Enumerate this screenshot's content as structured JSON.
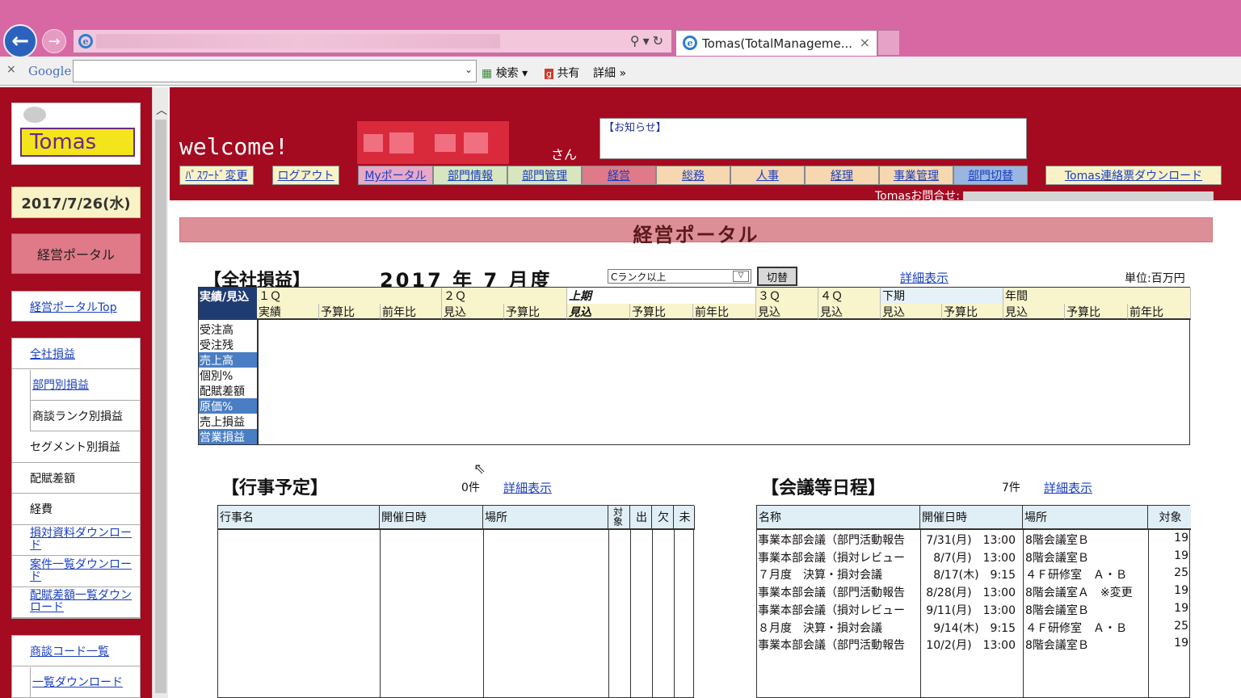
{
  "browser": {
    "tab_title": "Tomas(TotalManageme...",
    "tab_close": "×",
    "toolbar_close": "×",
    "google_logo": "Google",
    "search_label": "検索",
    "share_label": "共有",
    "detail_label": "詳細 »",
    "nav_back_icon": "back-arrow-icon",
    "nav_forward_icon": "forward-arrow-icon"
  },
  "sidebar": {
    "logo_text": "Tomas",
    "date": "2017/7/26(水)",
    "portal": "経営ポータル",
    "top_link": "経営ポータルTop",
    "group1": [
      {
        "label": "全社損益",
        "link": true
      },
      {
        "label": "部門別損益",
        "link": true,
        "sub": true
      },
      {
        "label": "商談ランク別損益",
        "link": false,
        "sub": true
      },
      {
        "label": "セグメント別損益",
        "link": false
      },
      {
        "label": "配賦差額",
        "link": false
      },
      {
        "label": "経費",
        "link": false
      },
      {
        "label": "損対資料ダウンロード",
        "link": true
      },
      {
        "label": "案件一覧ダウンロード",
        "link": true
      },
      {
        "label": "配賦差額一覧ダウンロード",
        "link": true
      }
    ],
    "group2": [
      {
        "label": "商談コード一覧",
        "link": true
      },
      {
        "label": "一覧ダウンロード",
        "link": true,
        "sub": true
      }
    ]
  },
  "header": {
    "welcome": "welcome!",
    "san": "さん",
    "notice_label": "【お知らせ】",
    "nav": [
      {
        "label": "ﾊﾟｽﾜｰﾄﾞ変更",
        "bg": "#f8f2c6"
      },
      {
        "label": "ログアウト",
        "bg": "#f8f2c6"
      },
      {
        "label": "Myポータル",
        "bg": "#e8a8c8"
      },
      {
        "label": "部門情報",
        "bg": "#d8e6c0"
      },
      {
        "label": "部門管理",
        "bg": "#d8e6c0"
      },
      {
        "label": "経営",
        "bg": "#e07a88"
      },
      {
        "label": "総務",
        "bg": "#f6d7b0"
      },
      {
        "label": "人事",
        "bg": "#f6d7b0"
      },
      {
        "label": "経理",
        "bg": "#f6d7b0"
      },
      {
        "label": "事業管理",
        "bg": "#f6d7b0"
      },
      {
        "label": "部門切替",
        "bg": "#9ab6e0"
      },
      {
        "label": "Tomas連絡票ダウンロード",
        "bg": "#f8f2c6"
      }
    ],
    "inquiry": "Tomasお問合せ:"
  },
  "main": {
    "title": "経営ポータル",
    "pl": {
      "heading": "【全社損益】",
      "period": "2017 年 7 月度",
      "rank_select": "Cランク以上",
      "switch_button": "切替",
      "detail_link": "詳細表示",
      "unit": "単位:百万円",
      "corner": "実績/見込",
      "groups": [
        "１Ｑ",
        "２Ｑ",
        "上期",
        "３Ｑ",
        "４Ｑ",
        "下期",
        "年間"
      ],
      "subcols": [
        "実績",
        "予算比",
        "前年比",
        "見込",
        "予算比",
        "見込",
        "予算比",
        "前年比",
        "見込",
        "見込",
        "見込",
        "予算比",
        "見込",
        "予算比",
        "前年比"
      ],
      "rows": [
        "受注高",
        "受注残",
        "売上高",
        "個別%",
        "配賦差額",
        "原価%",
        "売上損益",
        "営業損益"
      ]
    },
    "events": {
      "heading": "【行事予定】",
      "count": "0件",
      "detail_link": "詳細表示",
      "headers": [
        "行事名",
        "開催日時",
        "場所",
        "対象",
        "出",
        "欠",
        "未"
      ]
    },
    "meetings": {
      "heading": "【会議等日程】",
      "count": "7件",
      "detail_link": "詳細表示",
      "headers": [
        "名称",
        "開催日時",
        "場所",
        "対象"
      ],
      "rows": [
        [
          "事業本部会議（部門活動報告",
          "7/31(月)　13:00",
          "8階会議室Ｂ",
          "19"
        ],
        [
          "事業本部会議（損対レビュー",
          "8/7(月)　13:00",
          "8階会議室Ｂ",
          "19"
        ],
        [
          "７月度　決算・損対会議",
          "8/17(木)　9:15",
          "４Ｆ研修室　Ａ・Ｂ",
          "25"
        ],
        [
          "事業本部会議（部門活動報告",
          "8/28(月)　13:00",
          "8階会議室Ａ　※変更",
          "19"
        ],
        [
          "事業本部会議（損対レビュー",
          "9/11(月)　13:00",
          "8階会議室Ｂ",
          "19"
        ],
        [
          "８月度　決算・損対会議",
          "9/14(木)　9:15",
          "４Ｆ研修室　Ａ・Ｂ",
          "25"
        ],
        [
          "事業本部会議（部門活動報告",
          "10/2(月)　13:00",
          "8階会議室Ｂ",
          "19"
        ]
      ]
    }
  }
}
